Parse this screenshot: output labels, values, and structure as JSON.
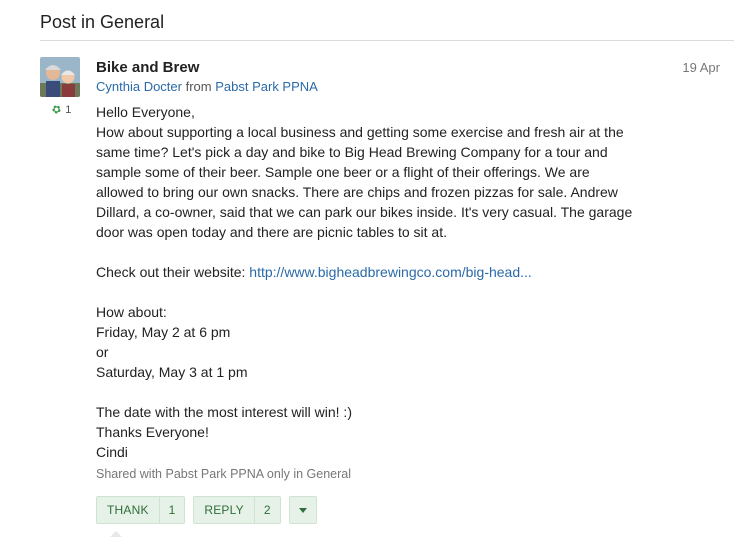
{
  "header": {
    "title": "Post in General"
  },
  "post": {
    "title": "Bike and Brew",
    "date": "19 Apr",
    "author": "Cynthia Docter",
    "from_word": "from",
    "group": "Pabst Park PPNA",
    "thanks_count": "1",
    "body": [
      "Hello Everyone,",
      "How about supporting a local business and getting some exercise and fresh air at the",
      "same time? Let's pick a day and bike to Big Head Brewing Company for a tour and",
      "sample some of their beer. Sample one beer or a flight of their offerings. We are",
      "allowed to bring our own snacks. There are chips and frozen pizzas for sale. Andrew",
      "Dillard, a co-owner, said that we can park our bikes inside. It's very casual. The garage",
      "door was open today and there are picnic tables to sit at."
    ],
    "website_prefix": "Check out their website: ",
    "website_link": "http://www.bigheadbrewingco.com/big-head...",
    "schedule": [
      "How about:",
      "Friday, May 2 at 6 pm",
      "or",
      "Saturday, May 3 at 1 pm"
    ],
    "closing": [
      "The date with the most interest will win! :)",
      "Thanks Everyone!",
      "Cindi"
    ],
    "shared_text": "Shared with Pabst Park PPNA only in General"
  },
  "actions": {
    "thank_label": "THANK",
    "thank_count": "1",
    "reply_label": "REPLY",
    "reply_count": "2"
  },
  "colors": {
    "link": "#2a6aa8",
    "button_bg": "#e6f2e7",
    "button_text": "#2f6e3b",
    "leaf": "#3f9b4c"
  }
}
